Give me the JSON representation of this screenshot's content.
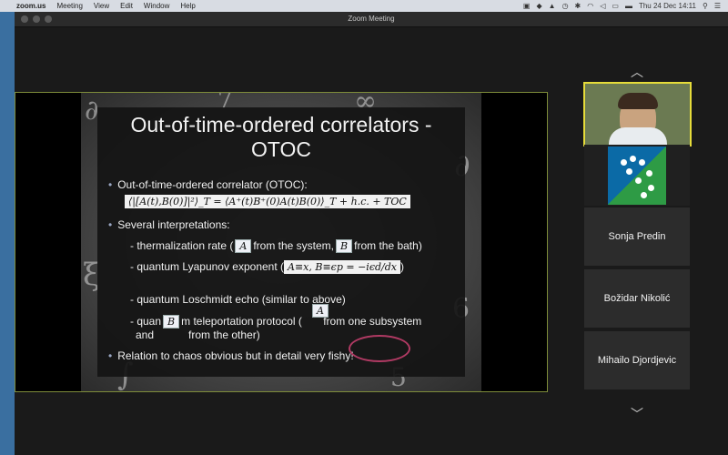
{
  "menubar": {
    "app_name": "zoom.us",
    "items": [
      "Meeting",
      "View",
      "Edit",
      "Window",
      "Help"
    ],
    "clock": "Thu 24 Dec  14:11"
  },
  "window": {
    "title": "Zoom Meeting"
  },
  "slide": {
    "title_line1": "Out-of-time-ordered correlators -",
    "title_line2": "OTOC",
    "bullet1": "Out-of-time-ordered correlator (OTOC):",
    "formula1": "⟨|[A(t),B(0)]|²⟩_T = ⟨A⁺(t)B⁺(0)A(t)B(0)⟩_T + h.c. + TOC",
    "bullet2": "Several interpretations:",
    "sub1_pre": "- thermalization rate (",
    "sub1_a": "A",
    "sub1_mid": "from the system,",
    "sub1_b": "B",
    "sub1_post": "from the bath)",
    "sub2_pre": "- quantum Lyapunov exponent (",
    "sub2_formula": "A≡x,  B≡ϵp = −iϵd/dx",
    "sub2_post": ")",
    "sub3": "- quantum Loschmidt echo (similar to above)",
    "sub4_pre": "- quan",
    "sub4_b": "B",
    "sub4_mid": "m teleportation protocol (",
    "sub4_a": "A",
    "sub4_post": "from one subsystem",
    "sub4_line2": "and",
    "sub4_line2b": "from the other)",
    "bullet3": "Relation to chaos obvious but in detail very fishy!"
  },
  "participants": [
    {
      "name": "Sonja Predin"
    },
    {
      "name": "Božidar Nikolić"
    },
    {
      "name": "Mihailo Djordjevic"
    }
  ],
  "icons": {
    "scroll_up": "chevron-up-icon",
    "scroll_down": "chevron-down-icon"
  }
}
